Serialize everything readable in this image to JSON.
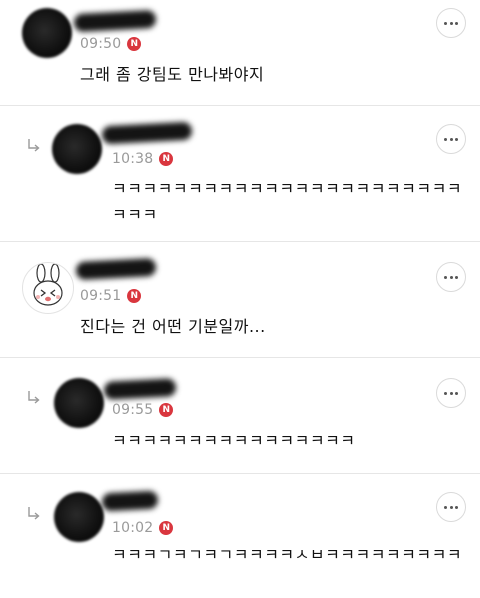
{
  "comments": [
    {
      "is_reply": false,
      "time": "09:50",
      "badge": "N",
      "text": "그래 좀 강팀도 만나봐야지",
      "avatar": "dark"
    },
    {
      "is_reply": true,
      "time": "10:38",
      "badge": "N",
      "text": "ㅋㅋㅋㅋㅋㅋㅋㅋㅋㅋㅋㅋㅋㅋㅋㅋㅋㅋㅋㅋㅋㅋㅋㅋㅋㅋ",
      "avatar": "dark"
    },
    {
      "is_reply": false,
      "time": "09:51",
      "badge": "N",
      "text": "진다는 건 어떤 기분일까...",
      "avatar": "bunny"
    },
    {
      "is_reply": true,
      "time": "09:55",
      "badge": "N",
      "text": "ㅋㅋㅋㅋㅋㅋㅋㅋㅋㅋㅋㅋㅋㅋㅋㅋ",
      "avatar": "dark"
    },
    {
      "is_reply": true,
      "time": "10:02",
      "badge": "N",
      "text": "ㅋㅋㅋㄱㅋㄱㅋㄱㅋㅋㅋㅋㅅㅂㅋㅋㅋㅋㅋㅋㅋㅋㅋ",
      "avatar": "dark"
    }
  ],
  "icons": {
    "more": "more-options-icon",
    "reply": "reply-arrow-icon",
    "badge": "new-badge"
  },
  "colors": {
    "badge": "#d9363e",
    "meta": "#9a9a9a",
    "divider": "#e6e6e6"
  }
}
